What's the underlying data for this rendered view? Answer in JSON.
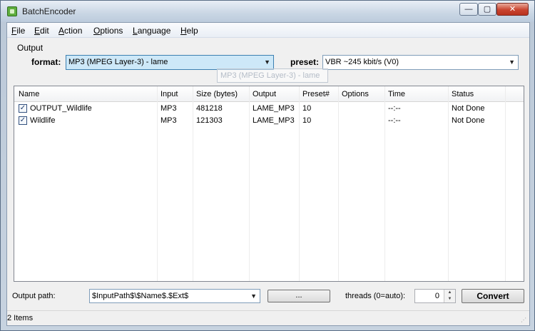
{
  "window": {
    "title": "BatchEncoder",
    "minimize_glyph": "—",
    "maximize_glyph": "▢",
    "close_glyph": "✕"
  },
  "menu": {
    "items": [
      {
        "label": "File"
      },
      {
        "label": "Edit"
      },
      {
        "label": "Action"
      },
      {
        "label": "Options"
      },
      {
        "label": "Language"
      },
      {
        "label": "Help"
      }
    ]
  },
  "output": {
    "group_label": "Output",
    "format_label": "format:",
    "format_value": "MP3 (MPEG Layer-3) - lame",
    "preset_label": "preset:",
    "preset_value": "VBR ~245 kbit/s (V0)",
    "drag_ghost_text": "MP3 (MPEG Layer-3) - lame"
  },
  "table": {
    "columns": [
      "Name",
      "Input",
      "Size (bytes)",
      "Output",
      "Preset#",
      "Options",
      "Time",
      "Status"
    ],
    "rows": [
      {
        "checked": true,
        "name": "OUTPUT_Wildlife",
        "input": "MP3",
        "size": "481218",
        "output": "LAME_MP3",
        "preset": "10",
        "options": "",
        "time": "--:--",
        "status": "Not Done"
      },
      {
        "checked": true,
        "name": "Wildlife",
        "input": "MP3",
        "size": "121303",
        "output": "LAME_MP3",
        "preset": "10",
        "options": "",
        "time": "--:--",
        "status": "Not Done"
      }
    ]
  },
  "bottom": {
    "output_path_label": "Output path:",
    "output_path_value": "$InputPath$\\$Name$.$Ext$",
    "browse_label": "...",
    "threads_label": "threads (0=auto):",
    "threads_value": "0",
    "convert_label": "Convert"
  },
  "status": {
    "text": "2 Items"
  }
}
